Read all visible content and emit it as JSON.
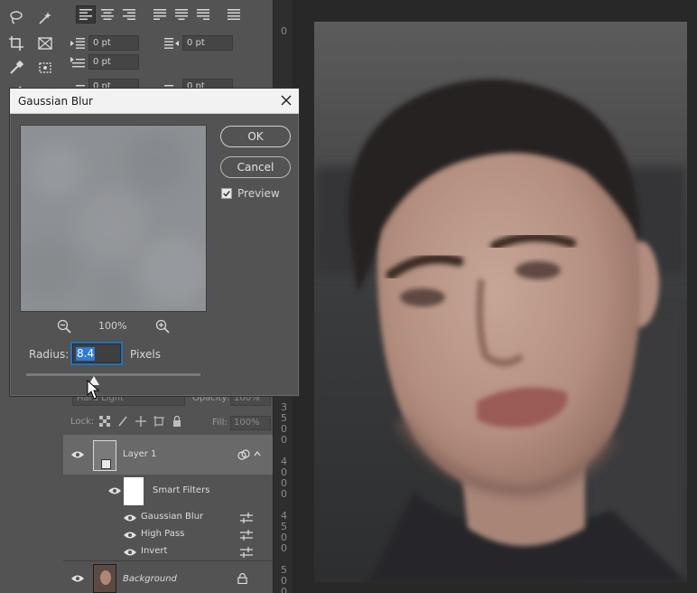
{
  "dialog": {
    "title": "Gaussian Blur",
    "ok_label": "OK",
    "cancel_label": "Cancel",
    "preview_label": "Preview",
    "preview_checked": true,
    "zoom_level": "100%",
    "radius_label": "Radius:",
    "radius_value": "8.4",
    "radius_units": "Pixels",
    "slider_position": 0.39
  },
  "paragraph": {
    "indent_left": "0 pt",
    "indent_right": "0 pt",
    "first_line": "0 pt",
    "space_before": "0 pt",
    "space_after": "0 pt"
  },
  "layers": {
    "blend_mode": "Hard Light",
    "opacity_label": "Opacity:",
    "opacity_value": "100%",
    "lock_label": "Lock:",
    "fill_label": "Fill:",
    "fill_value": "100%",
    "items": [
      {
        "name": "Layer 1"
      },
      {
        "name": "Smart Filters"
      },
      {
        "name": "Gaussian Blur"
      },
      {
        "name": "High Pass"
      },
      {
        "name": "Invert"
      },
      {
        "name": "Background"
      }
    ]
  },
  "ruler": {
    "top_mark": "0",
    "marks_a": [
      "3",
      "5",
      "0",
      "0"
    ],
    "marks_b": [
      "4",
      "0",
      "0",
      "0"
    ],
    "marks_c": [
      "4",
      "5",
      "0",
      "0"
    ],
    "marks_d": [
      "5",
      "0",
      "0"
    ]
  },
  "colors": {
    "panel": "#535353",
    "canvas_bg": "#282828",
    "accent": "#2f7bd6"
  }
}
